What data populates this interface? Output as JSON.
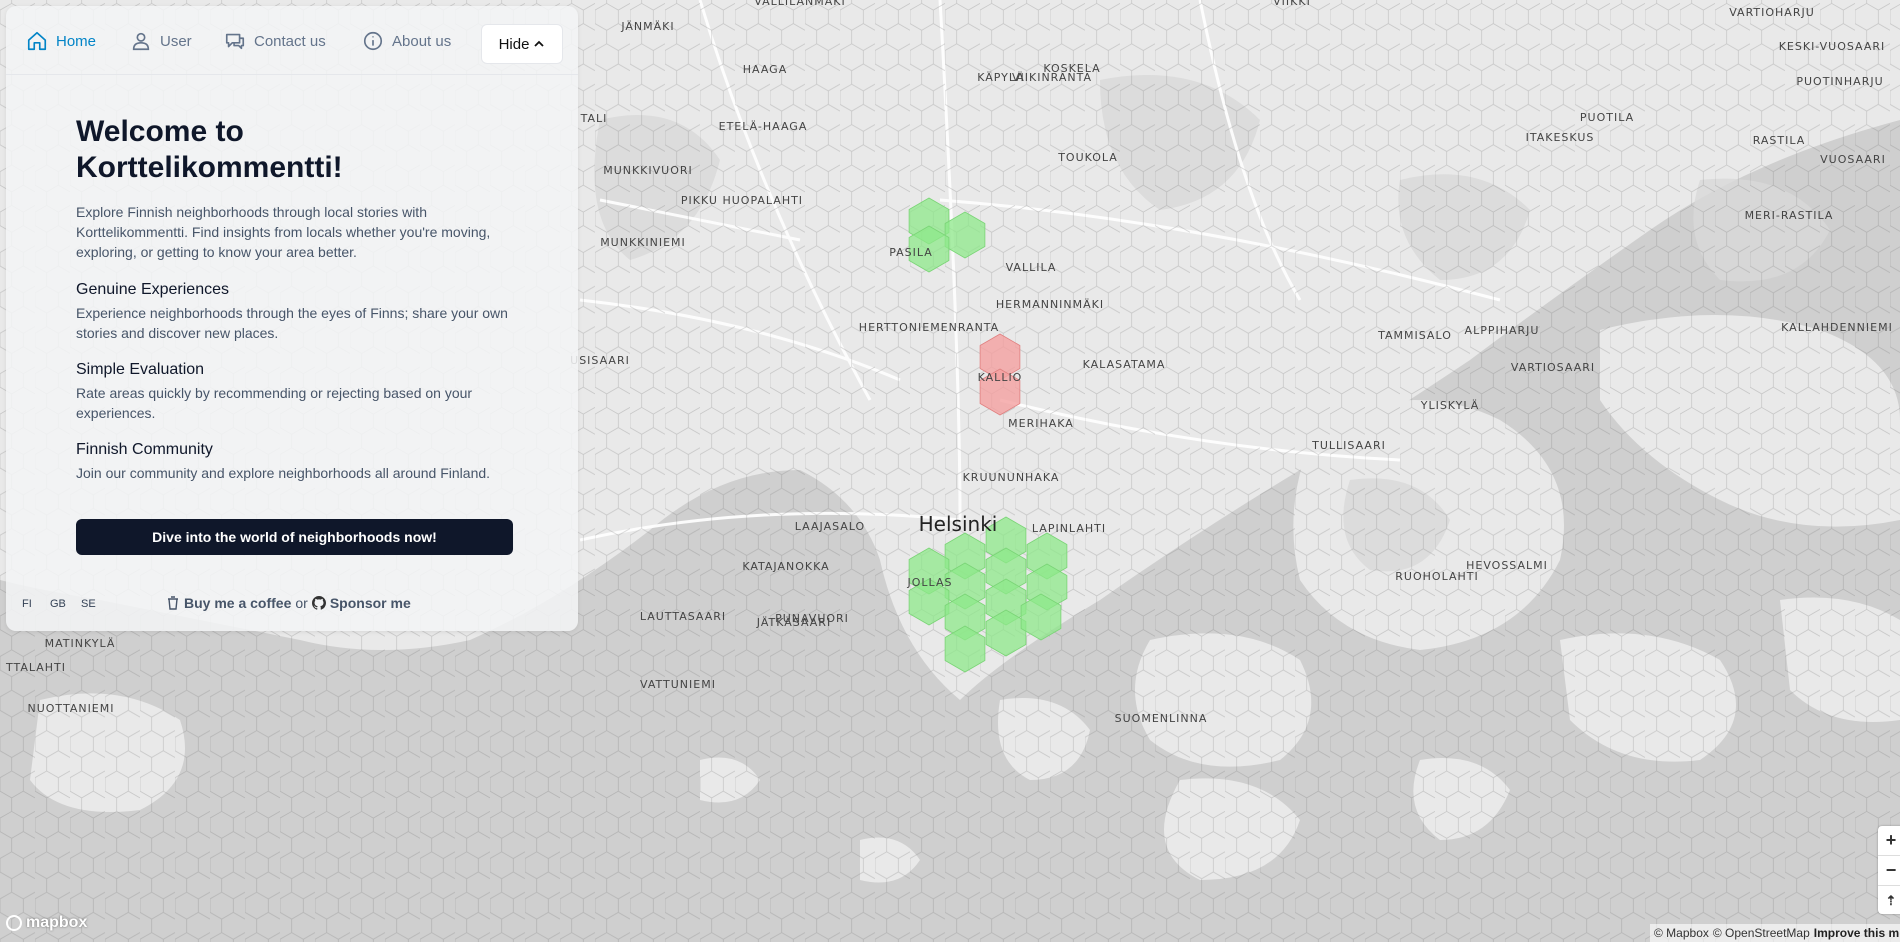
{
  "nav": {
    "items": [
      {
        "label": "Home",
        "icon": "home-icon",
        "active": true
      },
      {
        "label": "User",
        "icon": "user-icon"
      },
      {
        "label": "Contact us",
        "icon": "chat-icon"
      },
      {
        "label": "About us",
        "icon": "info-icon"
      }
    ],
    "hide_label": "Hide"
  },
  "welcome": {
    "title": "Welcome to Korttelikommentti!",
    "intro": "Explore Finnish neighborhoods through local stories with Korttelikommentti. Find insights from locals whether you're moving, exploring, or getting to know your area better.",
    "features": [
      {
        "heading": "Genuine Experiences",
        "text": "Experience neighborhoods through the eyes of Finns; share your own stories and discover new places."
      },
      {
        "heading": "Simple Evaluation",
        "text": "Rate areas quickly by recommending or rejecting based on your experiences."
      },
      {
        "heading": "Finnish Community",
        "text": "Join our community and explore neighborhoods all around Finland."
      }
    ],
    "cta": "Dive into the world of neighborhoods now!"
  },
  "footer": {
    "languages": [
      "FI",
      "GB",
      "SE"
    ],
    "coffee": "Buy me a coffee",
    "or": "or",
    "sponsor": "Sponsor me"
  },
  "map": {
    "city": "Helsinki",
    "places": [
      "VALLILANMÄKI",
      "JÄNMÄKI",
      "VIIKKI",
      "VARTIOHARJU",
      "KESKI-VUOSAARI",
      "KOSKELA",
      "HAAGA",
      "KÄPYLÄ",
      "VIIKINRANTA",
      "PUOTINHARJU",
      "ETELÄ-HAAGA",
      "TALI",
      "PUOTILA",
      "ITAKESKUS",
      "RASTILA",
      "TOUKOLA",
      "MUNKKIVUORI",
      "VUOSAARI",
      "PIKKU HUOPALAHTI",
      "PASILA",
      "MUNKKINIEMI",
      "VALLILA",
      "MERI-RASTILA",
      "HERMANNINMÄKI",
      "TAMMISALO",
      "ALPPIHARJU",
      "HERTTONIEMENRANTA",
      "KALLAHDENNIEMI",
      "USISAARI",
      "KALASATAMA",
      "VARTIOSAARI",
      "KALLIO",
      "YLISKYLÄ",
      "MERIHAKA",
      "TULLISAARI",
      "KRUUNUNHAKA",
      "LAAJASALO",
      "LAPINLAHTI",
      "KATAJANOKKA",
      "RUOHOLAHTI",
      "HEVOSSALMI",
      "JOLLAS",
      "PUNAVUORI",
      "LAUTTASAARI",
      "JÄTKÄSAARI",
      "MATINKYLÄ",
      "TTALAHTI",
      "VATTUNIEMI",
      "SUOMENLINNA",
      "NUOTTANIEMI"
    ],
    "green_cells": 16,
    "red_cells": 2
  },
  "controls": {
    "zoom_in": "+",
    "zoom_out": "−",
    "compass": "⇡"
  },
  "attribution": {
    "mapbox": "© Mapbox",
    "osm": "© OpenStreetMap",
    "improve": "Improve this m"
  },
  "logo": "mapbox",
  "colors": {
    "accent": "#0284c7",
    "cta": "#0f172a",
    "good_cell": "#8ee88a",
    "bad_cell": "#f4a0a0"
  }
}
